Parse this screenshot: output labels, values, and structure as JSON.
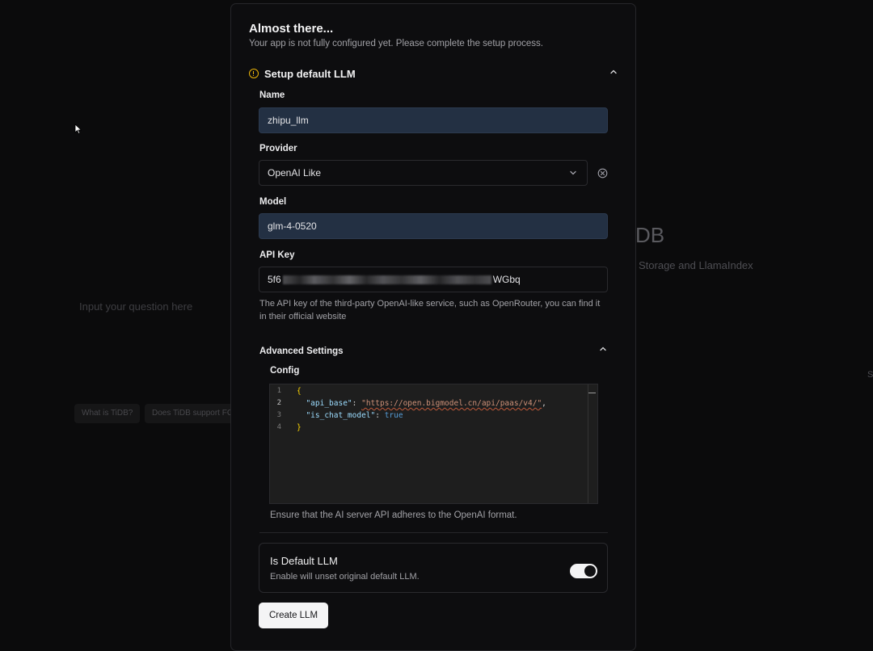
{
  "background": {
    "title": "DB",
    "subtitle": "Storage and LlamaIndex",
    "input_placeholder": "Input your question here",
    "suggestions": [
      "What is TiDB?",
      "Does TiDB support FC"
    ],
    "edge_text": "S"
  },
  "dialog": {
    "title": "Almost there...",
    "description": "Your app is not fully configured yet. Please complete the setup process.",
    "section": {
      "title": "Setup default LLM",
      "icon": "warning-icon",
      "accent_color": "#eab308"
    },
    "fields": {
      "name": {
        "label": "Name",
        "value": "zhipu_llm"
      },
      "provider": {
        "label": "Provider",
        "value": "OpenAI Like"
      },
      "model": {
        "label": "Model",
        "value": "glm-4-0520"
      },
      "api_key": {
        "label": "API Key",
        "value_prefix": "5f6",
        "value_suffix": "WGbq",
        "help": "The API key of the third-party OpenAI-like service, such as OpenRouter, you can find it in their official website"
      }
    },
    "advanced": {
      "title": "Advanced Settings",
      "config_label": "Config",
      "code_lines": [
        {
          "n": "1",
          "open": "{"
        },
        {
          "n": "2",
          "key": "\"api_base\"",
          "sep": ": ",
          "val": "\"https://open.bigmodel.cn/api/paas/v4/\"",
          "tail": ","
        },
        {
          "n": "3",
          "key": "\"is_chat_model\"",
          "sep": ": ",
          "val": "true"
        },
        {
          "n": "4",
          "close": "}"
        }
      ],
      "note": "Ensure that the AI server API adheres to the OpenAI format."
    },
    "default_llm": {
      "title": "Is Default LLM",
      "description": "Enable will unset original default LLM.",
      "enabled": true
    },
    "submit_label": "Create LLM"
  }
}
